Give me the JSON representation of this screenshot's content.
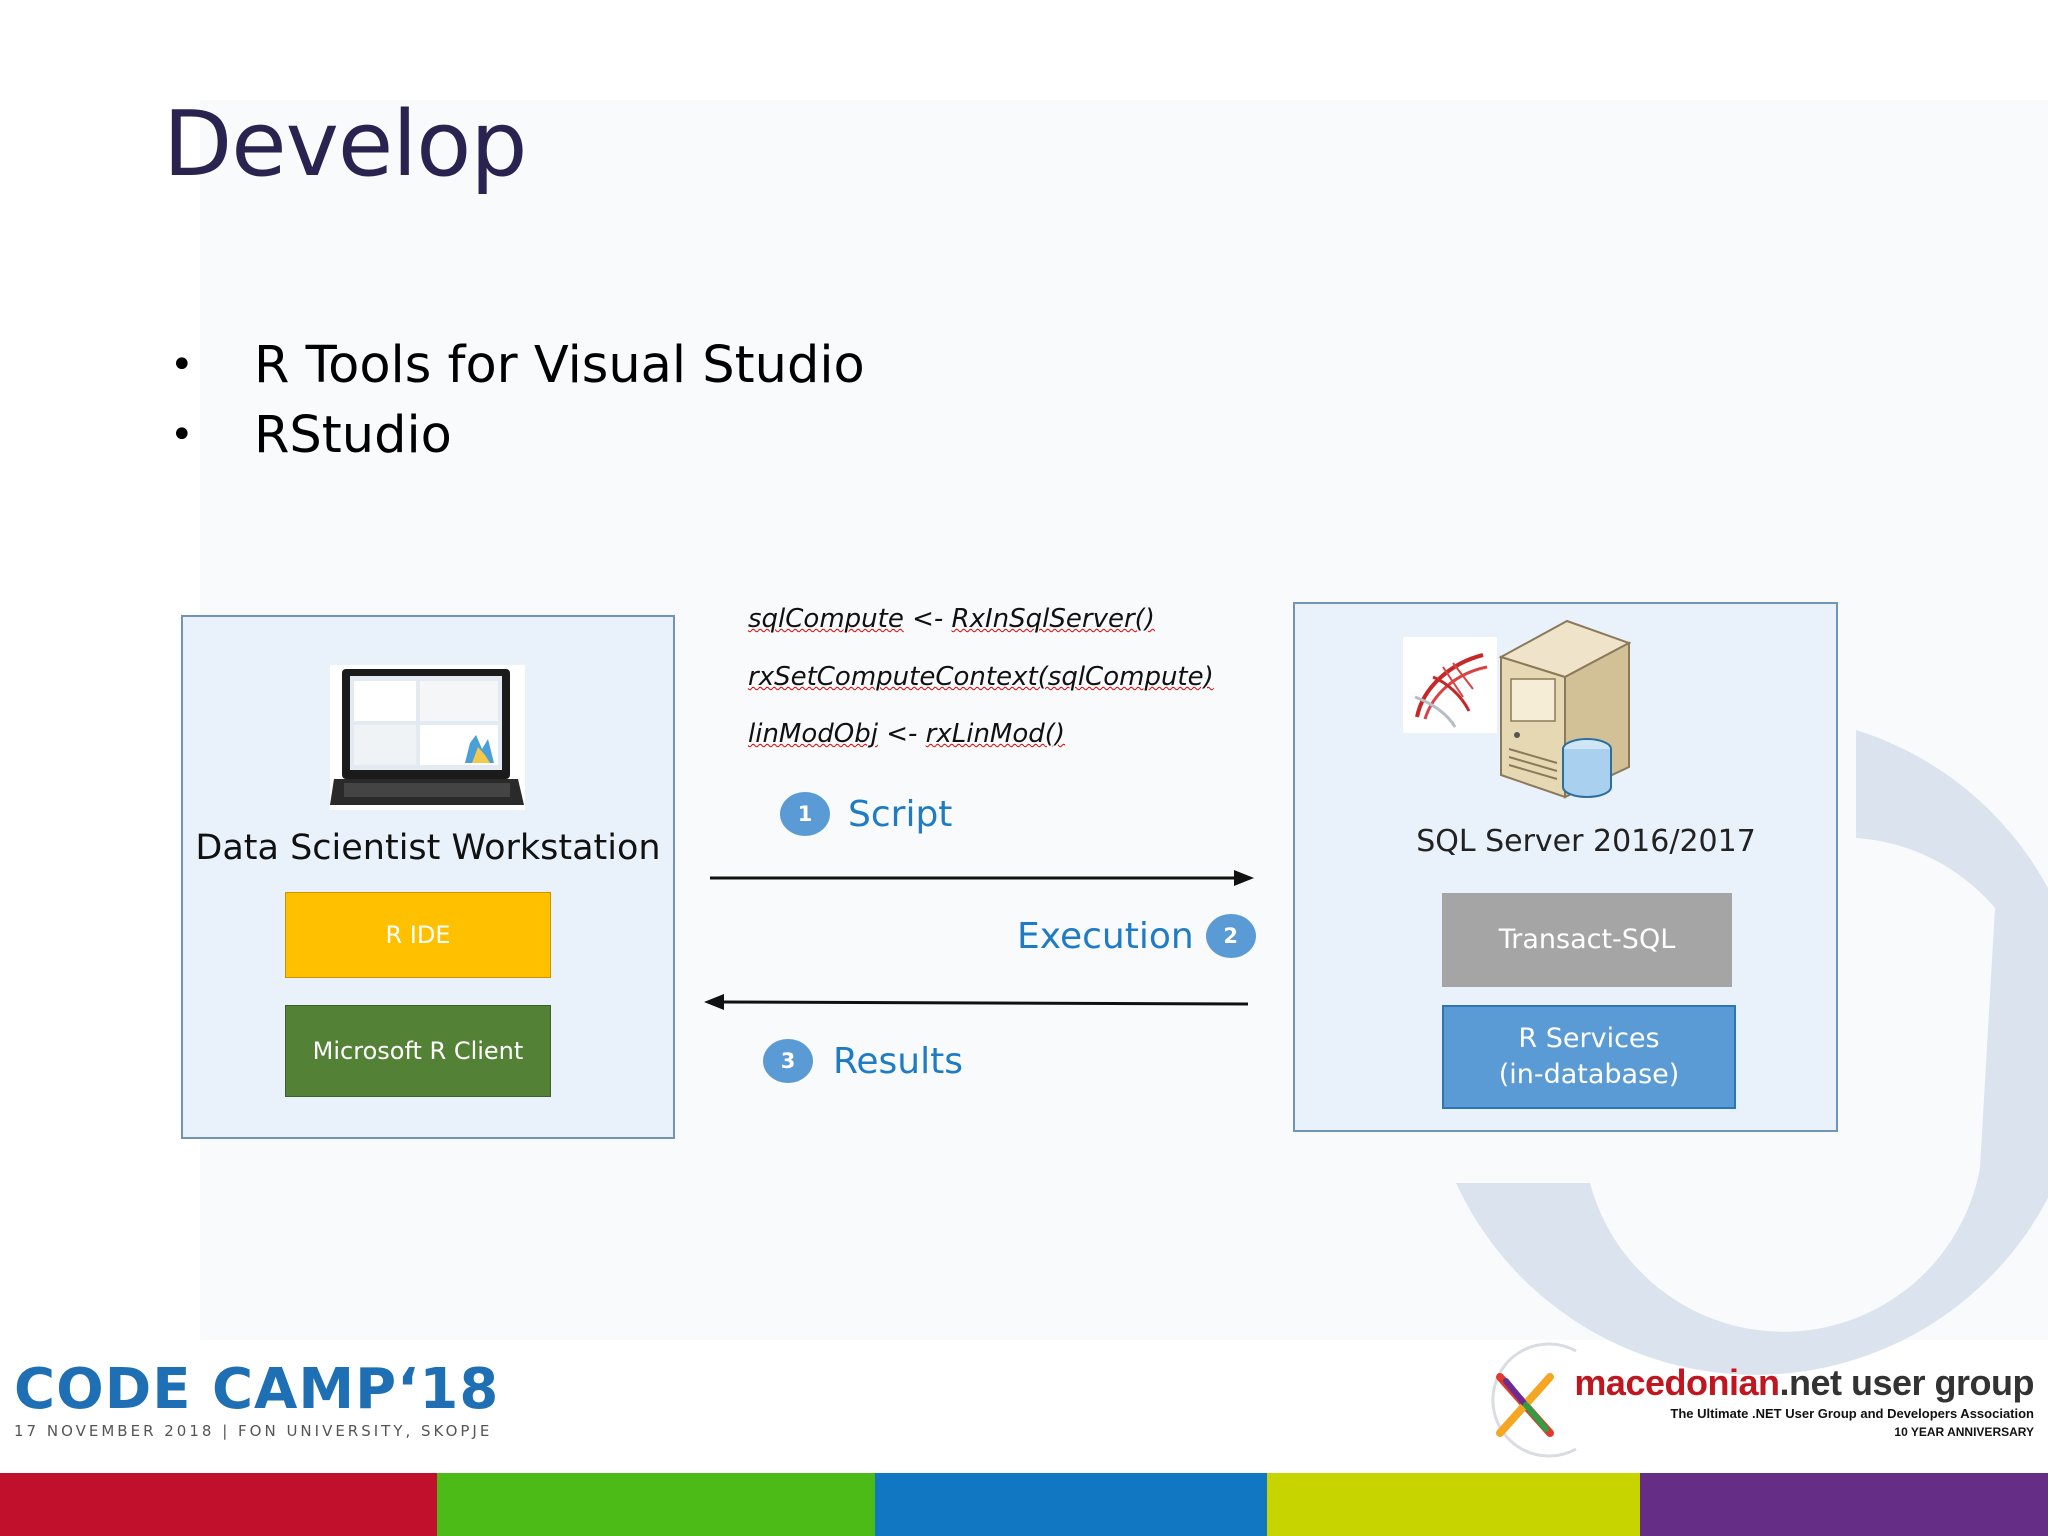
{
  "title": "Develop",
  "bullets": [
    "R Tools for Visual Studio",
    "RStudio"
  ],
  "workstation": {
    "label": "Data Scientist Workstation",
    "r_ide": "R IDE",
    "r_client": "Microsoft R Client"
  },
  "server": {
    "label": "SQL Server 2016/2017",
    "tsql": "Transact-SQL",
    "r_services_line1": "R Services",
    "r_services_line2": "(in-database)"
  },
  "code": {
    "line1_a": "sqlCompute",
    "line1_b": " <- ",
    "line1_c": "RxInSqlServer()",
    "line2": "rxSetComputeContext(sqlCompute)",
    "line3_a": "linModObj",
    "line3_b": " <- ",
    "line3_c": "rxLinMod()"
  },
  "steps": [
    {
      "num": "1",
      "label": "Script"
    },
    {
      "num": "2",
      "label": "Execution"
    },
    {
      "num": "3",
      "label": "Results"
    }
  ],
  "footer": {
    "codecamp_title": "CODE CAMP‘18",
    "codecamp_sub": "17 NOVEMBER 2018 | FON UNIVERSITY, SKOPJE",
    "mnug_brand": "macedonian",
    "mnug_rest": ".net user group",
    "mnug_tagline": "The Ultimate .NET User Group and Developers Association",
    "mnug_anniv": "10 YEAR ANNIVERSARY"
  },
  "colors": {
    "title": "#2a2350",
    "r_ide": "#ffc000",
    "r_client": "#538135",
    "tsql": "#a5a5a5",
    "r_services": "#5b9bd5",
    "step_text": "#1f7bc4",
    "bar": [
      "#c0102b",
      "#4cbb17",
      "#1177c2",
      "#c7d400",
      "#662d86"
    ]
  }
}
